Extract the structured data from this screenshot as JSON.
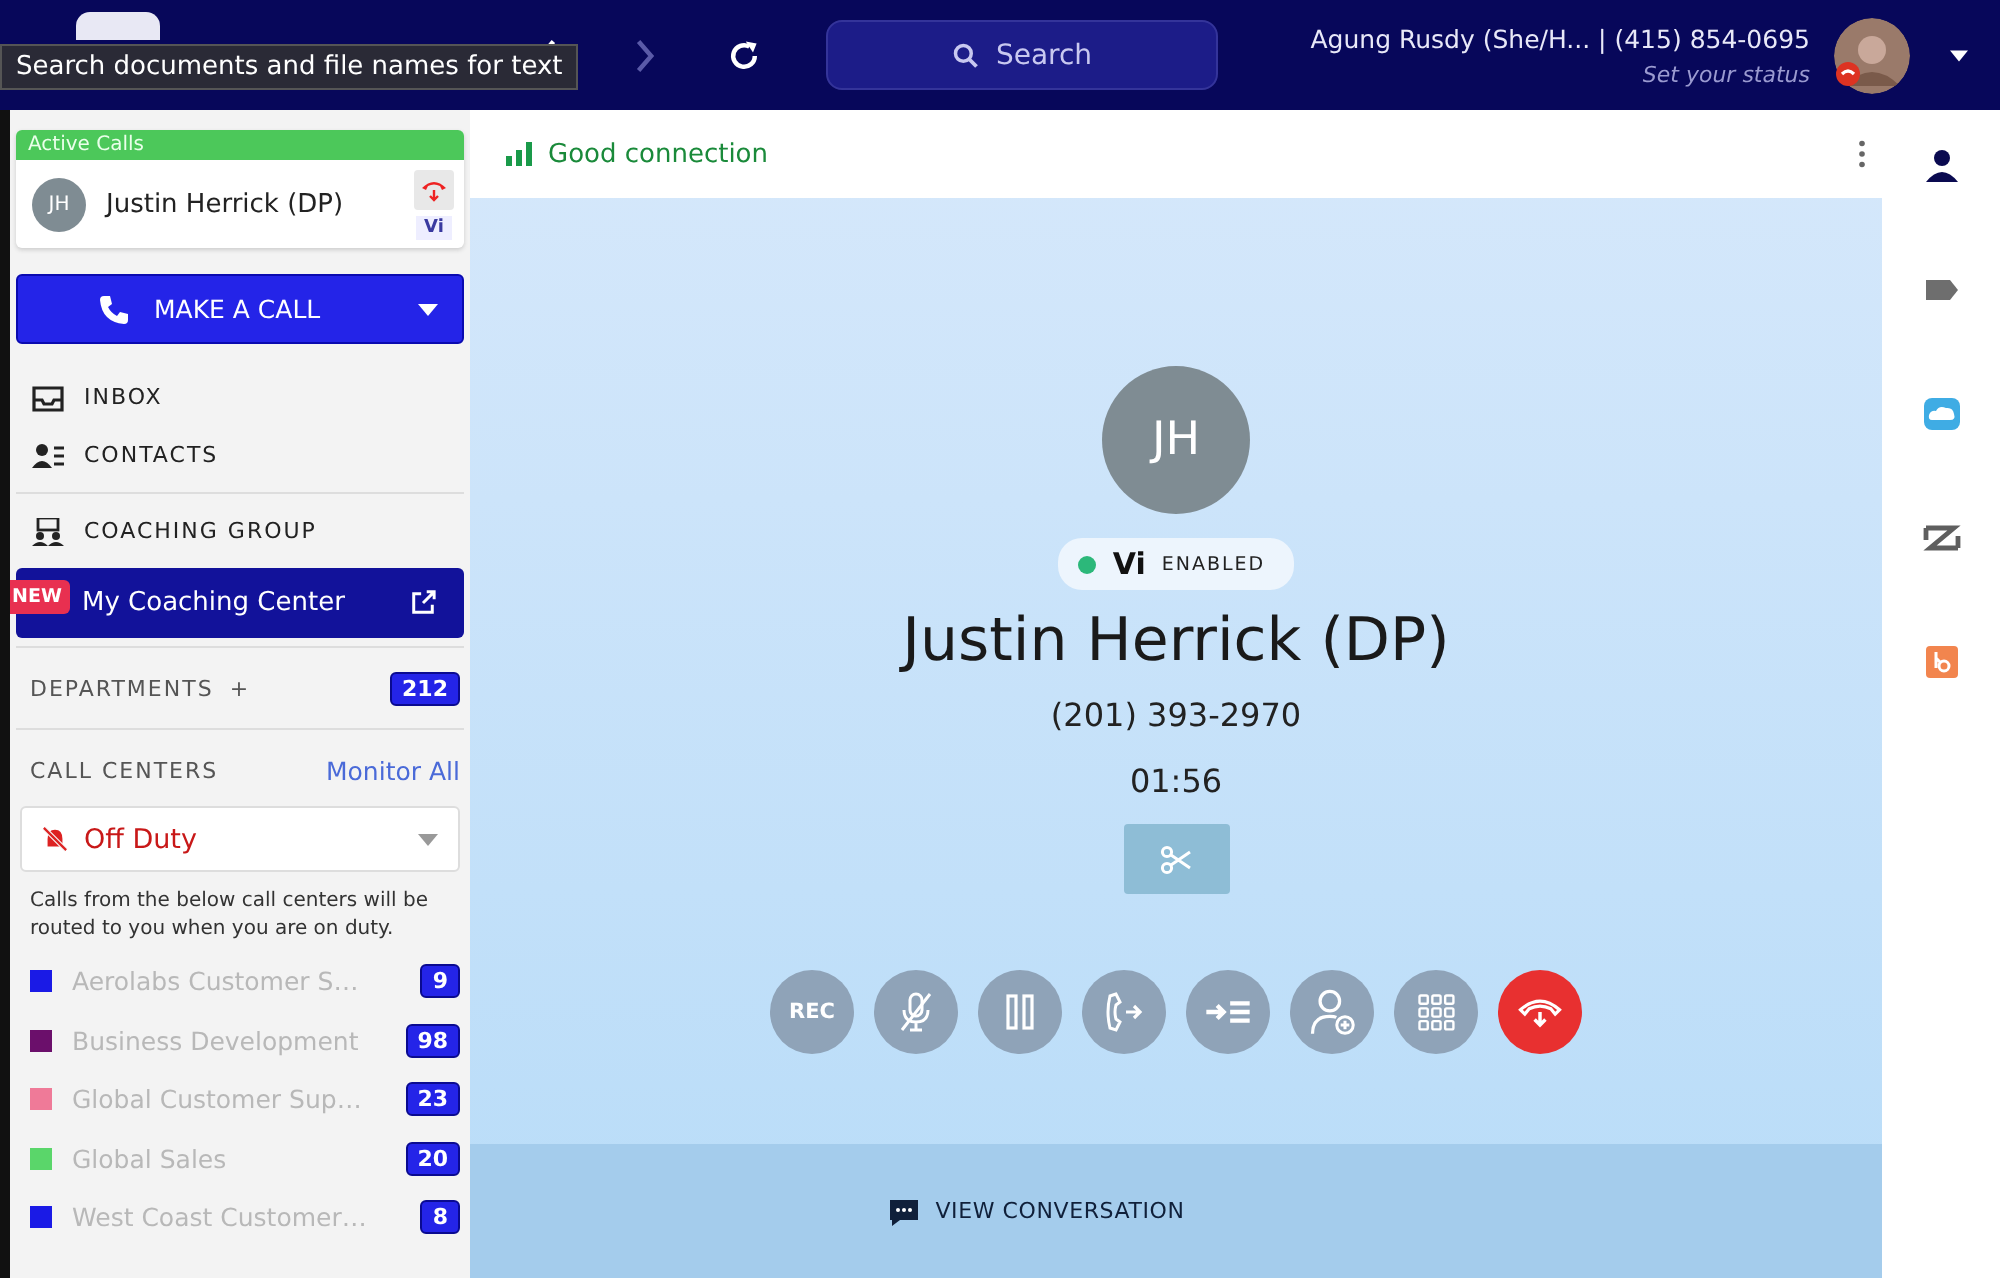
{
  "tooltip": "Search documents and file names for text",
  "topbar": {
    "search_placeholder": "Search",
    "user": "Agung Rusdy (She/H... | (415) 854-0695",
    "status": "Set your status"
  },
  "active_calls": {
    "title": "Active Calls",
    "initials": "JH",
    "name": "Justin Herrick (DP)",
    "vi": "Vi"
  },
  "make_call": "MAKE A CALL",
  "nav": [
    {
      "kind": "inbox",
      "label": "INBOX"
    },
    {
      "kind": "contacts",
      "label": "CONTACTS"
    },
    {
      "kind": "coaching",
      "label": "COACHING GROUP"
    }
  ],
  "coaching_center": {
    "badge": "NEW",
    "label": "My Coaching Center"
  },
  "departments": {
    "label": "DEPARTMENTS",
    "plus": "+",
    "count": "212"
  },
  "call_centers": {
    "label": "CALL CENTERS",
    "link": "Monitor All",
    "status": "Off Duty",
    "note": "Calls from the below call centers will be routed to you when you are on duty.",
    "items": [
      {
        "name": "Aerolabs Customer S…",
        "count": "9",
        "color": "#1a1ae6"
      },
      {
        "name": "Business Development",
        "count": "98",
        "color": "#6b0f6b"
      },
      {
        "name": "Global Customer Sup…",
        "count": "23",
        "color": "#ef7a98"
      },
      {
        "name": "Global Sales",
        "count": "20",
        "color": "#5ad66a"
      },
      {
        "name": "West Coast Customer…",
        "count": "8",
        "color": "#1a1ae6"
      }
    ]
  },
  "call": {
    "connection": "Good connection",
    "initials": "JH",
    "vi": "Vi",
    "vi_status": "ENABLED",
    "name": "Justin Herrick (DP)",
    "phone": "(201) 393-2970",
    "timer": "01:56",
    "controls": [
      {
        "kind": "rec",
        "label": "REC"
      },
      {
        "kind": "mute"
      },
      {
        "kind": "hold"
      },
      {
        "kind": "transfer"
      },
      {
        "kind": "queue"
      },
      {
        "kind": "add"
      },
      {
        "kind": "keypad"
      },
      {
        "kind": "hangup"
      }
    ],
    "view_conversation": "VIEW CONVERSATION"
  },
  "rail": [
    {
      "kind": "person",
      "selected": true
    },
    {
      "kind": "tag",
      "selected": false
    },
    {
      "kind": "cloud",
      "selected": false
    },
    {
      "kind": "z",
      "selected": false
    },
    {
      "kind": "hub",
      "selected": false
    }
  ]
}
